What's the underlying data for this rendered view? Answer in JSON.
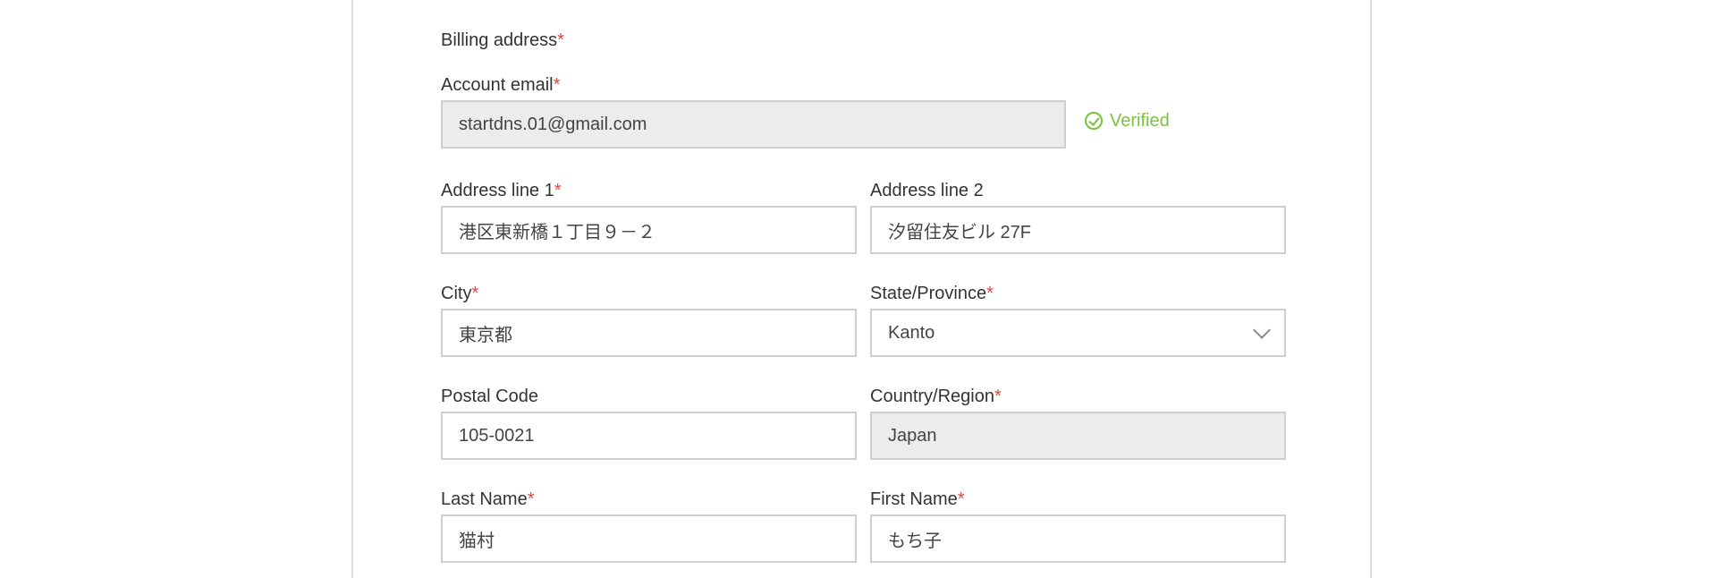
{
  "section_title": "Billing address",
  "required_marker": "*",
  "account_email": {
    "label": "Account email",
    "value": "startdns.01@gmail.com",
    "status": "Verified"
  },
  "address_line_1": {
    "label": "Address line 1",
    "value": "港区東新橋１丁目９－２"
  },
  "address_line_2": {
    "label": "Address line 2",
    "value": "汐留住友ビル 27F"
  },
  "city": {
    "label": "City",
    "value": "東京都"
  },
  "state": {
    "label": "State/Province",
    "value": "Kanto"
  },
  "postal_code": {
    "label": "Postal Code",
    "value": "105-0021"
  },
  "country": {
    "label": "Country/Region",
    "value": "Japan"
  },
  "last_name": {
    "label": "Last Name",
    "value": "猫村"
  },
  "first_name": {
    "label": "First Name",
    "value": "もち子"
  },
  "colors": {
    "required": "#e0483e",
    "verified": "#7cc142",
    "readonly_bg": "#ececec",
    "border": "#cfcfcf"
  },
  "icons": {
    "verified": "check-circle-icon",
    "dropdown": "chevron-down-icon"
  }
}
